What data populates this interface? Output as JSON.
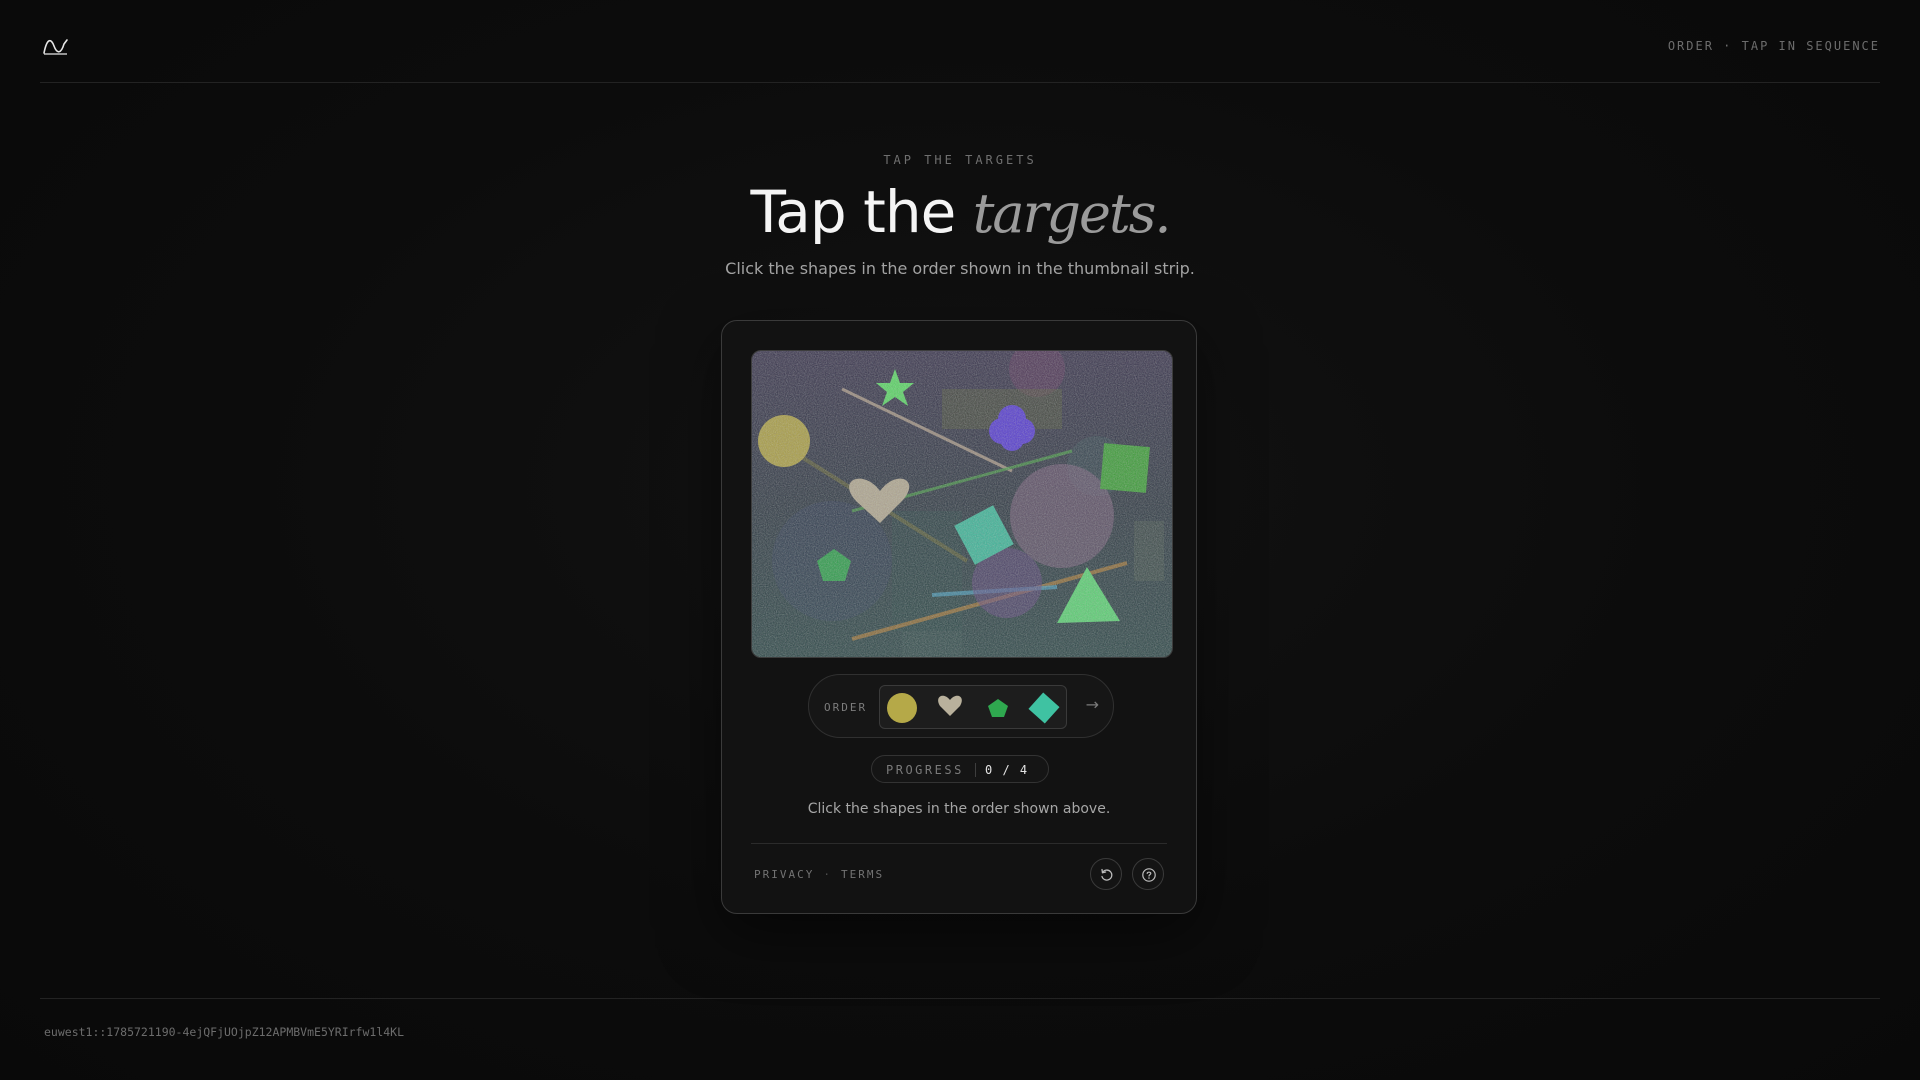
{
  "header": {
    "logo_icon": "wave-logo-icon",
    "status": "ORDER · TAP IN SEQUENCE"
  },
  "hero": {
    "eyebrow": "TAP THE TARGETS",
    "title_plain": "Tap the ",
    "title_accent": "targets.",
    "subtitle": "Click the shapes in the order shown in the thumbnail strip."
  },
  "challenge": {
    "canvas_shapes": [
      "star",
      "flower",
      "circle",
      "square",
      "heart",
      "square-diamond",
      "large-circle",
      "pentagon",
      "triangle"
    ],
    "order_label": "ORDER",
    "order_sequence": [
      {
        "shape": "circle",
        "color": "#b5a948"
      },
      {
        "shape": "heart",
        "color": "#b9b19c"
      },
      {
        "shape": "pentagon",
        "color": "#2fa84f"
      },
      {
        "shape": "diamond",
        "color": "#3fc2a2"
      }
    ],
    "order_arrow_icon": "arrow-right-icon",
    "progress_label": "PROGRESS",
    "progress_value": "0 / 4",
    "instruction": "Click the shapes in the order shown above."
  },
  "footer": {
    "privacy": "PRIVACY",
    "separator": "·",
    "terms": "TERMS",
    "refresh_icon": "refresh-icon",
    "help_icon": "help-icon"
  },
  "session": {
    "id": "euwest1::1785721190-4ejQFjUOjpZ12APMBVmE5YRIrfw1l4KL"
  },
  "colors": {
    "background": "#0b0b0b",
    "card": "#121212",
    "accent_green": "#5fe07a"
  }
}
